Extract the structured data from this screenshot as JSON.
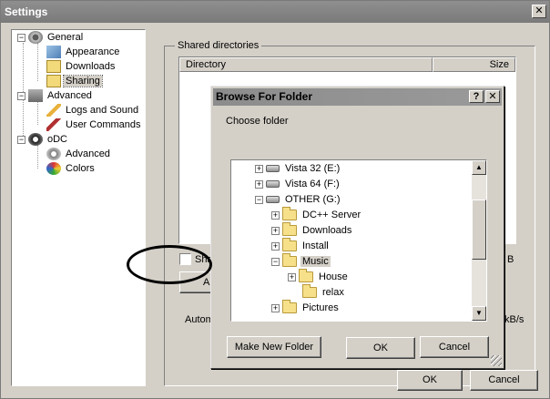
{
  "window": {
    "title": "Settings",
    "close_label": "✕"
  },
  "tree": {
    "nodes": [
      {
        "label": "General",
        "toggle": "−",
        "icon": "gear-globe-icon"
      },
      {
        "label": "Appearance",
        "icon": "appearance-icon"
      },
      {
        "label": "Downloads",
        "icon": "downloads-icon"
      },
      {
        "label": "Sharing",
        "icon": "sharing-folder-icon",
        "selected": true
      },
      {
        "label": "Advanced",
        "toggle": "−",
        "icon": "advanced-icon"
      },
      {
        "label": "Logs and Sound",
        "icon": "pencil-icon"
      },
      {
        "label": "User Commands",
        "icon": "tools-icon"
      },
      {
        "label": "oDC",
        "toggle": "−",
        "icon": "odc-icon"
      },
      {
        "label": "Advanced",
        "icon": "settings-gear-icon"
      },
      {
        "label": "Colors",
        "icon": "palette-icon"
      }
    ]
  },
  "sharing": {
    "group_label": "Shared directories",
    "columns": {
      "directory": "Directory",
      "size": "Size"
    },
    "checkbox_partial": "Sha",
    "button_partial": "A",
    "right_partial_1": "B",
    "auto_partial": "Autom",
    "right_partial_2": "kB/s"
  },
  "footer": {
    "ok": "OK",
    "cancel": "Cancel"
  },
  "browse_dialog": {
    "title": "Browse For Folder",
    "help": "?",
    "close": "✕",
    "prompt": "Choose folder",
    "folders": [
      {
        "label": "Vista 32 (E:)",
        "toggle": "+",
        "type": "drive"
      },
      {
        "label": "Vista 64 (F:)",
        "toggle": "+",
        "type": "drive"
      },
      {
        "label": "OTHER (G:)",
        "toggle": "−",
        "type": "drive"
      },
      {
        "label": "DC++ Server",
        "toggle": "+",
        "type": "folder"
      },
      {
        "label": "Downloads",
        "toggle": "+",
        "type": "folder"
      },
      {
        "label": "Install",
        "toggle": "+",
        "type": "folder"
      },
      {
        "label": "Music",
        "toggle": "−",
        "type": "folder",
        "selected": true
      },
      {
        "label": "House",
        "toggle": "+",
        "type": "folder"
      },
      {
        "label": "relax",
        "toggle": "",
        "type": "folder"
      },
      {
        "label": "Pictures",
        "toggle": "+",
        "type": "folder"
      }
    ],
    "scroll_up": "▲",
    "scroll_down": "▼",
    "make_new_folder": "Make New Folder",
    "ok": "OK",
    "cancel": "Cancel"
  }
}
